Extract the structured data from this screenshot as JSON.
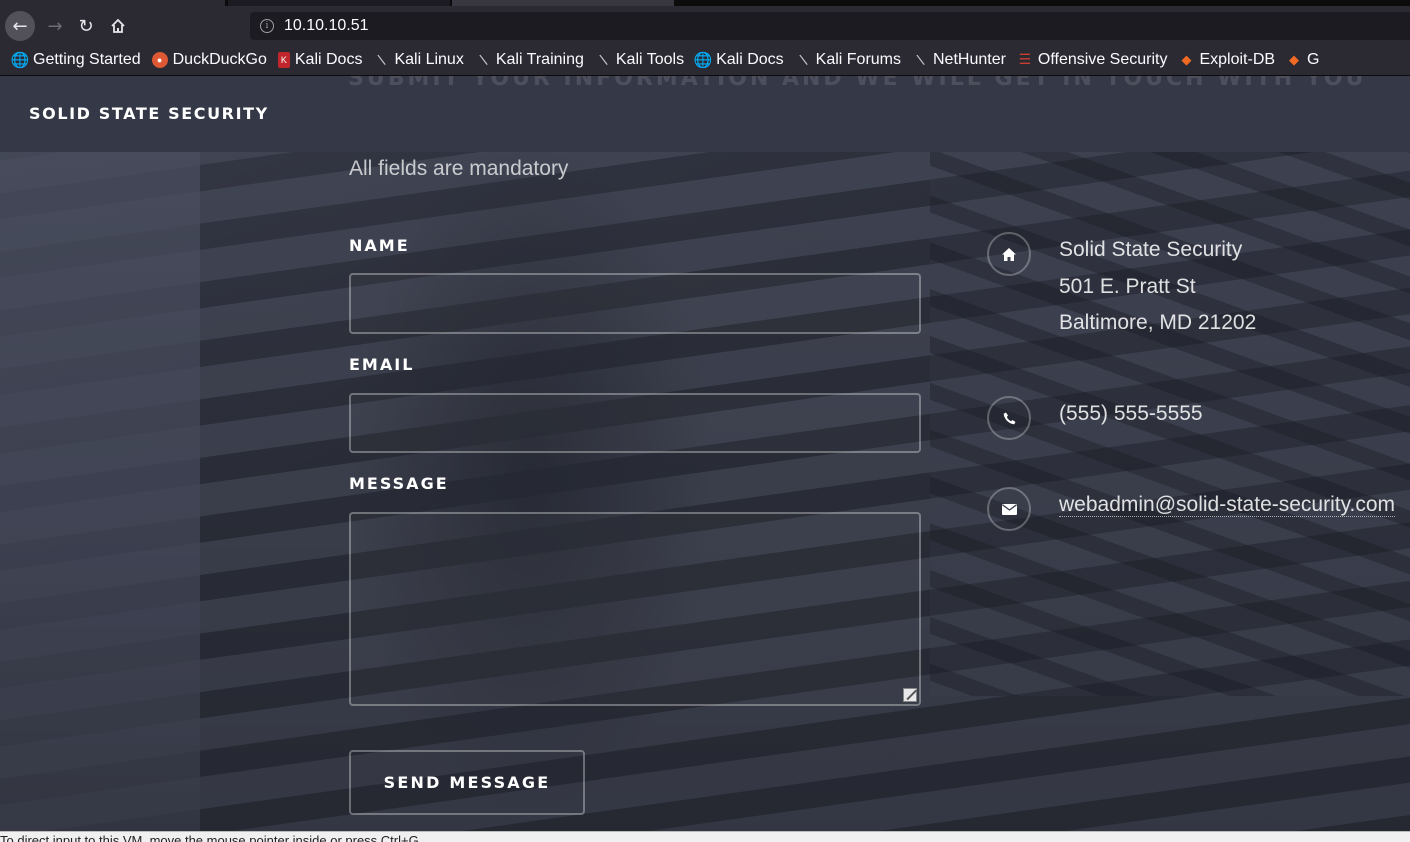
{
  "browser": {
    "url": "10.10.10.51",
    "bookmarks": [
      {
        "label": "Getting Started",
        "icon": "globe-icon"
      },
      {
        "label": "DuckDuckGo",
        "icon": "duckduckgo-icon"
      },
      {
        "label": "Kali Docs",
        "icon": "kali-docs-icon"
      },
      {
        "label": "Kali Linux",
        "icon": "kali-dragon-icon"
      },
      {
        "label": "Kali Training",
        "icon": "kali-dragon-icon"
      },
      {
        "label": "Kali Tools",
        "icon": "kali-dragon-icon"
      },
      {
        "label": "Kali Docs",
        "icon": "globe-icon"
      },
      {
        "label": "Kali Forums",
        "icon": "kali-dragon-icon"
      },
      {
        "label": "NetHunter",
        "icon": "kali-dragon-icon"
      },
      {
        "label": "Offensive Security",
        "icon": "offsec-icon"
      },
      {
        "label": "Exploit-DB",
        "icon": "exploit-db-icon"
      },
      {
        "label": "G",
        "icon": "exploit-db-icon"
      }
    ]
  },
  "site": {
    "brand": "SOLID STATE SECURITY",
    "ghost_heading": "SUBMIT YOUR INFORMATION AND WE WILL GET IN TOUCH WITH YOU"
  },
  "form": {
    "subtitle": "All fields are mandatory",
    "name_label": "NAME",
    "name_value": "",
    "email_label": "EMAIL",
    "email_value": "",
    "message_label": "MESSAGE",
    "message_value": "",
    "submit_label": "SEND MESSAGE"
  },
  "contact": {
    "address_line1": "Solid State Security",
    "address_line2": "501 E. Pratt St",
    "address_line3": "Baltimore, MD 21202",
    "phone": "(555) 555-5555",
    "email": "webadmin@solid-state-security.com"
  },
  "statusbar": {
    "text": "To direct input to this VM, move the mouse pointer inside or press Ctrl+G."
  },
  "colors": {
    "chrome_bg": "#2b2a33",
    "url_bg": "#1c1b22",
    "header_bg": "#353846",
    "text_white": "#ffffff"
  }
}
